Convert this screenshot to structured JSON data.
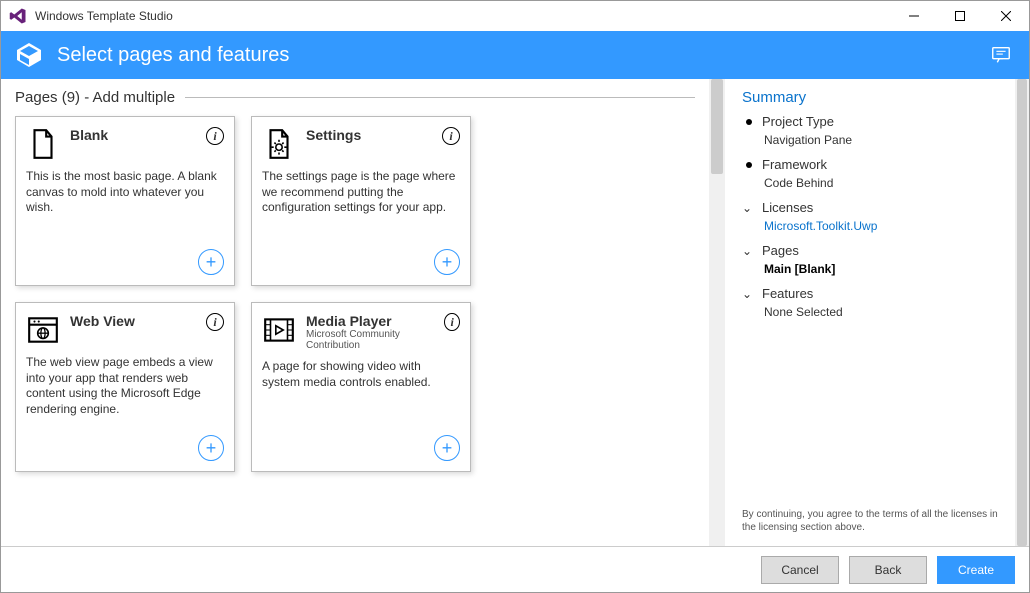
{
  "titlebar": {
    "title": "Windows Template Studio"
  },
  "header": {
    "title": "Select pages and features"
  },
  "section": {
    "label": "Pages (9) - Add multiple"
  },
  "cards": [
    {
      "title": "Blank",
      "subtitle": "",
      "desc": "This is the most basic page. A blank canvas to mold into whatever you wish.",
      "icon": "doc"
    },
    {
      "title": "Settings",
      "subtitle": "",
      "desc": "The settings page is the page where we recommend putting the configuration settings for your app.",
      "icon": "gear"
    },
    {
      "title": "Web View",
      "subtitle": "",
      "desc": "The web view page embeds a view into your app that renders web content using the Microsoft Edge rendering engine.",
      "icon": "web"
    },
    {
      "title": "Media Player",
      "subtitle": "Microsoft Community Contribution",
      "desc": "A page for showing video with system media controls enabled.",
      "icon": "media"
    }
  ],
  "summary": {
    "title": "Summary",
    "projectType": {
      "label": "Project Type",
      "value": "Navigation Pane"
    },
    "framework": {
      "label": "Framework",
      "value": "Code Behind"
    },
    "licenses": {
      "label": "Licenses",
      "link": "Microsoft.Toolkit.Uwp"
    },
    "pages": {
      "label": "Pages",
      "value": "Main [Blank]"
    },
    "features": {
      "label": "Features",
      "value": "None Selected"
    },
    "disclaimer": "By continuing, you agree to the terms of all the licenses in the licensing section above."
  },
  "footer": {
    "cancel": "Cancel",
    "back": "Back",
    "create": "Create"
  }
}
